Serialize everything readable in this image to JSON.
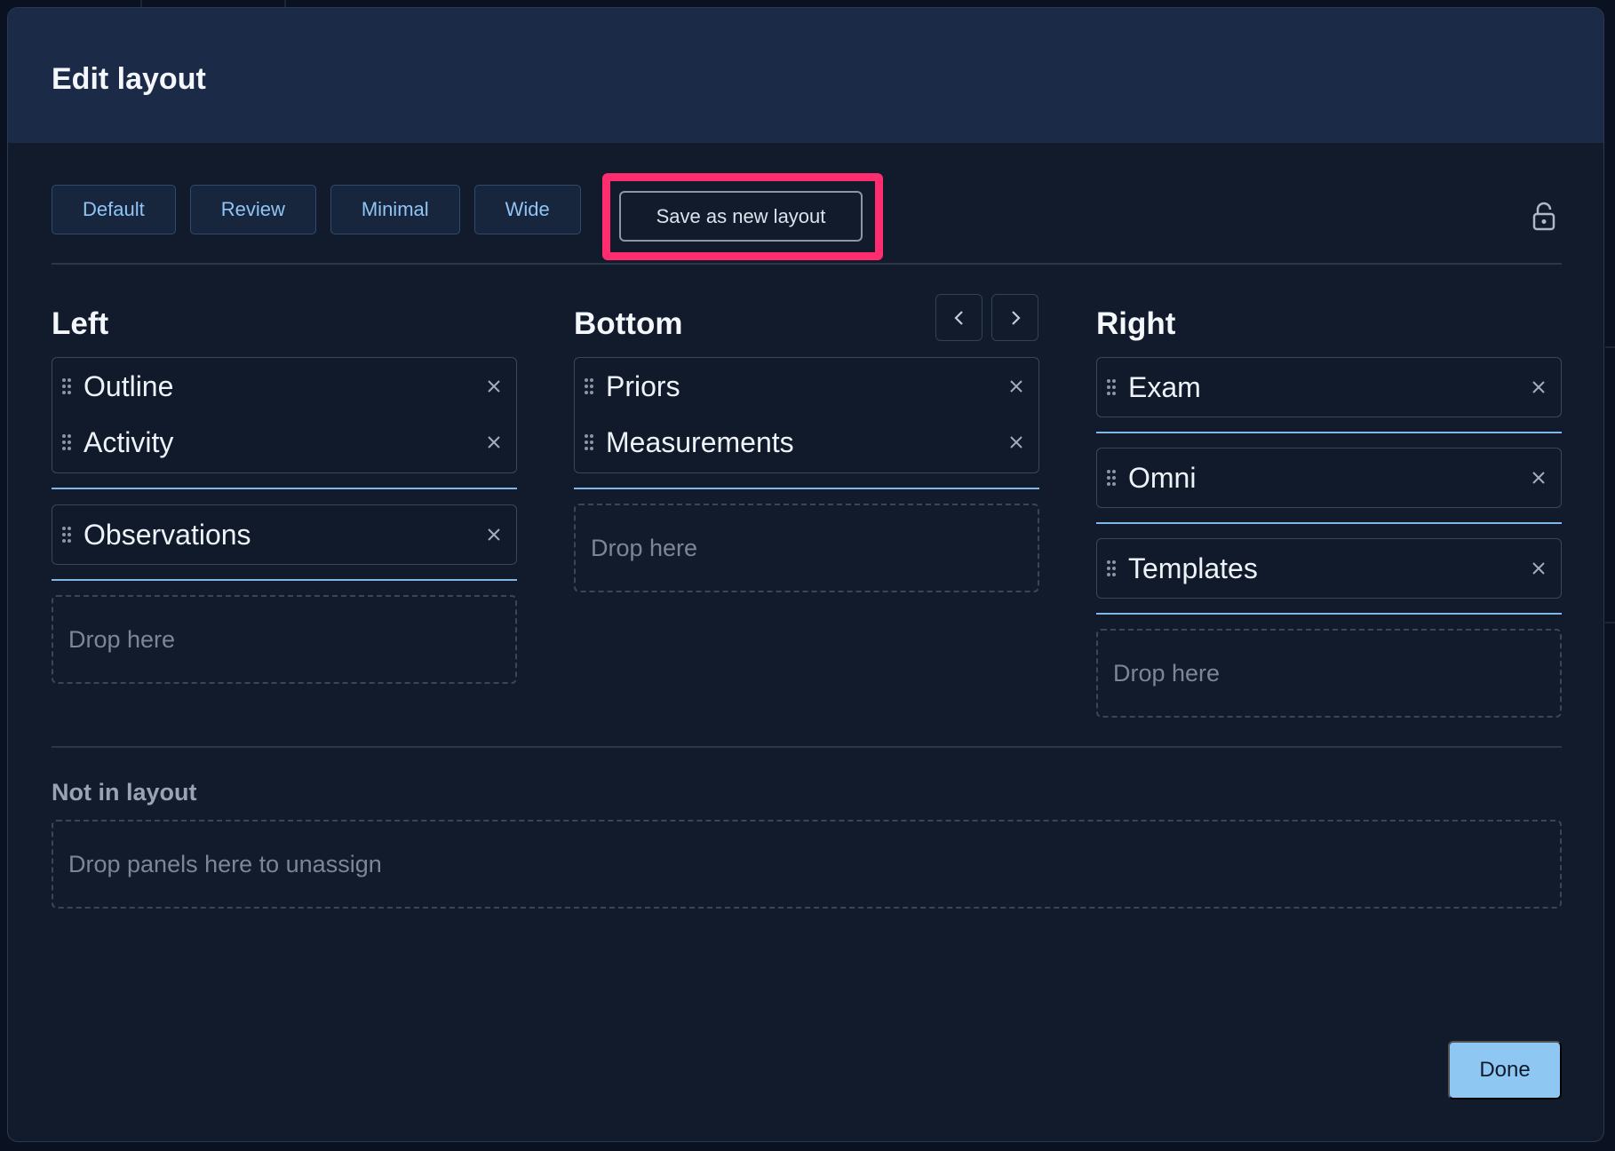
{
  "modal": {
    "title": "Edit layout"
  },
  "presets": [
    "Default",
    "Review",
    "Minimal",
    "Wide"
  ],
  "save_button": "Save as new layout",
  "lock_icon": "lock-open-icon",
  "columns": {
    "left": {
      "title": "Left",
      "groups": [
        [
          "Outline",
          "Activity"
        ],
        [
          "Observations"
        ]
      ],
      "drop_label": "Drop here"
    },
    "bottom": {
      "title": "Bottom",
      "groups": [
        [
          "Priors",
          "Measurements"
        ]
      ],
      "drop_label": "Drop here"
    },
    "right": {
      "title": "Right",
      "groups": [
        [
          "Exam"
        ],
        [
          "Omni"
        ],
        [
          "Templates"
        ]
      ],
      "drop_label": "Drop here"
    }
  },
  "not_in_layout": {
    "title": "Not in layout",
    "drop_label": "Drop panels here to unassign"
  },
  "done_button": "Done",
  "colors": {
    "accent": "#8fc7f3",
    "highlight": "#ff2d6f",
    "header_bg": "#1b2a47",
    "modal_bg": "#121b2c"
  }
}
